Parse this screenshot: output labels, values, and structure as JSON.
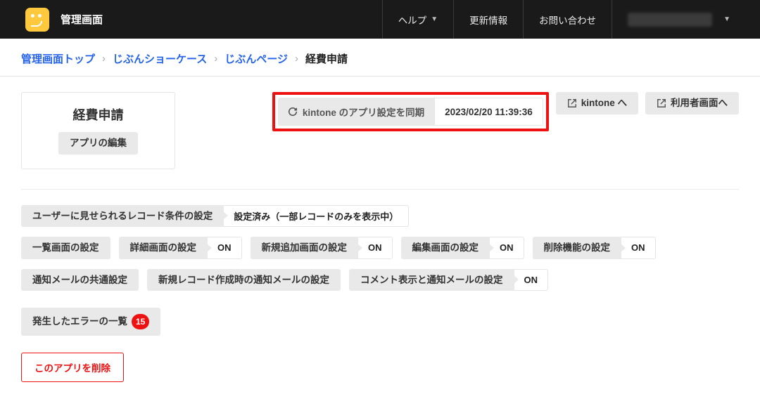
{
  "header": {
    "brand": "管理画面",
    "nav": {
      "help": "ヘルプ",
      "updates": "更新情報",
      "contact": "お問い合わせ"
    }
  },
  "crumbs": {
    "c1": "管理画面トップ",
    "c2": "じぶんショーケース",
    "c3": "じぶんページ",
    "c4": "経費申請"
  },
  "title": "経費申請",
  "edit_app": "アプリの編集",
  "sync": {
    "label": "kintone のアプリ設定を同期",
    "time": "2023/02/20 11:39:36"
  },
  "links": {
    "to_kintone": "kintone へ",
    "to_user": "利用者画面へ"
  },
  "rows": {
    "record_cond": {
      "label": "ユーザーに見せられるレコード条件の設定",
      "status": "設定済み（一部レコードのみを表示中）"
    },
    "list": {
      "label": "一覧画面の設定"
    },
    "detail": {
      "label": "詳細画面の設定",
      "status": "ON"
    },
    "create": {
      "label": "新規追加画面の設定",
      "status": "ON"
    },
    "edit": {
      "label": "編集画面の設定",
      "status": "ON"
    },
    "delete": {
      "label": "削除機能の設定",
      "status": "ON"
    },
    "mail_common": {
      "label": "通知メールの共通設定"
    },
    "mail_create": {
      "label": "新規レコード作成時の通知メールの設定"
    },
    "mail_comment": {
      "label": "コメント表示と通知メールの設定",
      "status": "ON"
    },
    "errors": {
      "label": "発生したエラーの一覧",
      "count": "15"
    }
  },
  "delete_app": "このアプリを削除"
}
